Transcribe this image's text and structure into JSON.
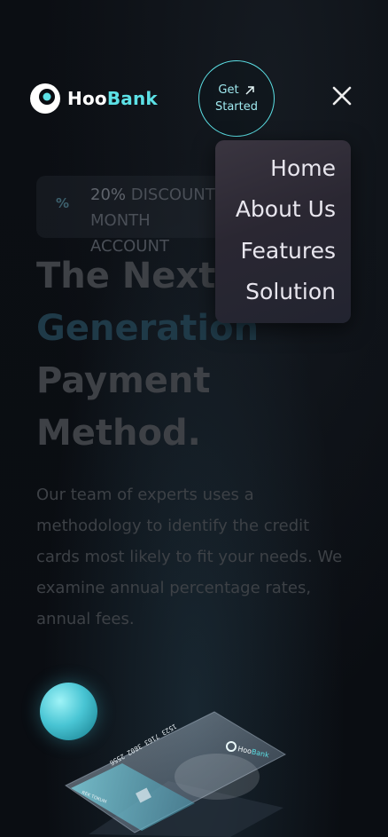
{
  "brand": {
    "name_prefix": "Hoo",
    "name_suffix": "Bank",
    "accent": "#5ce1e6"
  },
  "cta": {
    "line1": "Get",
    "line2": "Started",
    "icon": "arrow-up-right-icon"
  },
  "close_icon": "close-icon",
  "menu": {
    "items": [
      "Home",
      "About Us",
      "Features",
      "Solution"
    ]
  },
  "discount": {
    "icon": "%",
    "line1_lit": "20%",
    "line1_rest": " DISCOUNT FOR 1 MONTH",
    "line2": "ACCOUNT"
  },
  "hero": {
    "line1": "The Next",
    "line2": "Generation",
    "line3": "Payment",
    "line4": "Method.",
    "paragraph_lines": [
      "Our team of experts uses a",
      "methodology to identify the credit",
      "cards most likely to fit your needs. We",
      "examine annual percentage rates,",
      "annual fees."
    ]
  },
  "card": {
    "number": "1523 7163 3802 2556",
    "holder": "REK TOKUM",
    "brand_prefix": "Hoo",
    "brand_suffix": "Bank"
  }
}
